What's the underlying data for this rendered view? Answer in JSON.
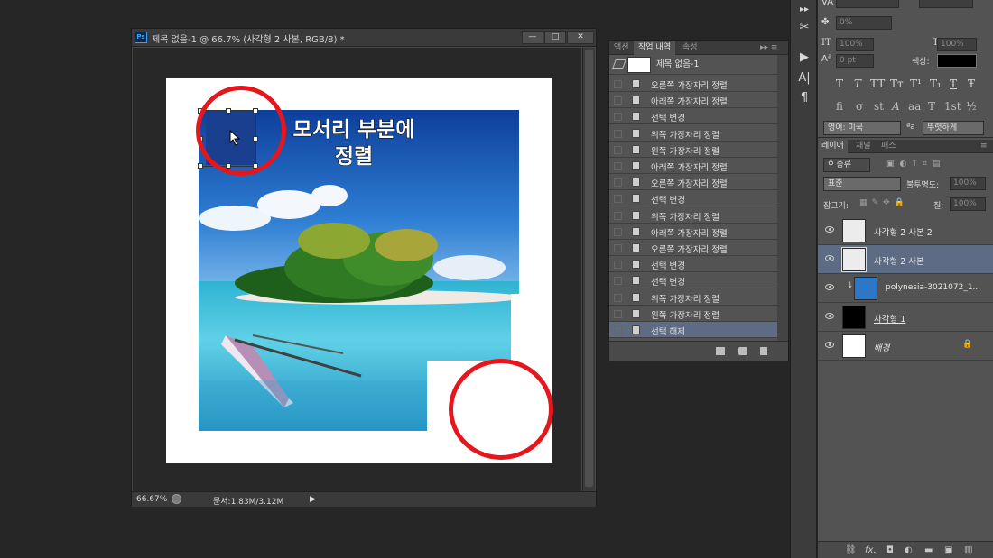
{
  "window": {
    "title": "제목 없음-1 @ 66.7% (사각형 2 사본, RGB/8) *",
    "logo": "Ps",
    "minimize": "—",
    "maximize": "□",
    "close": "✕",
    "zoom": "66.67%",
    "doc_info": "문서:1.83M/3.12M",
    "status_arrow": "▶"
  },
  "canvas": {
    "caption_line1": "모서리 부분에",
    "caption_line2": "정렬"
  },
  "history_panel": {
    "tabs": [
      "액션",
      "작업 내역",
      "속성"
    ],
    "active_tab": "작업 내역",
    "menu": "▸▸ ≡",
    "snapshot": "제목 없음-1",
    "items": [
      "오른쪽 가장자리 정렬",
      "아래쪽 가장자리 정렬",
      "선택 변경",
      "위쪽 가장자리 정렬",
      "왼쪽 가장자리 정렬",
      "아래쪽 가장자리 정렬",
      "오른쪽 가장자리 정렬",
      "선택 변경",
      "위쪽 가장자리 정렬",
      "아래쪽 가장자리 정렬",
      "오른쪽 가장자리 정렬",
      "선택 변경",
      "선택 변경",
      "위쪽 가장자리 정렬",
      "왼쪽 가장자리 정렬",
      "선택 해제"
    ],
    "selected_item": "선택 해제"
  },
  "character_panel": {
    "size_top": "0%",
    "tracking_label": "VA",
    "vertical_scale": "100%",
    "horizontal_scale": "100%",
    "baseline": "0 pt",
    "color_label": "색상:",
    "type_styles": [
      "T",
      "T",
      "TT",
      "Tт",
      "T¹",
      "T₁",
      "T",
      "Ŧ"
    ],
    "opentype": [
      "fi",
      "σ",
      "st",
      "A",
      "aa",
      "T",
      "1st",
      "½"
    ],
    "language": "영어: 미국",
    "aa_icon": "ªa",
    "antialias": "뚜렷하게",
    "colors": {
      "text_color": "#000000"
    }
  },
  "layers_panel": {
    "tabs": [
      "레이어",
      "채널",
      "패스"
    ],
    "active_tab": "레이어",
    "filter": "종류",
    "blend_mode": "표준",
    "opacity_label": "불투명도:",
    "opacity": "100%",
    "lock_label": "잠그기:",
    "fill_label": "칠:",
    "fill": "100%",
    "layers": [
      {
        "name": "사각형 2 사본 2",
        "thumb": "transparent"
      },
      {
        "name": "사각형 2 사본",
        "thumb": "transparent",
        "selected": true
      },
      {
        "name": "polynesia-3021072_1...",
        "thumb": "photo"
      },
      {
        "name": "사각형 1",
        "thumb": "black"
      },
      {
        "name": "배경",
        "thumb": "white",
        "locked": true
      }
    ],
    "bottom_icons": [
      "link-icon",
      "fx-icon",
      "mask-icon",
      "adjustment-icon",
      "group-icon",
      "new-layer-icon",
      "trash-icon"
    ],
    "fx_label": "fx."
  },
  "tool_icons": [
    "scissors-icon",
    "play-icon",
    "character-icon",
    "paragraph-icon"
  ],
  "colors": {
    "accent": "#e5171d",
    "selection": "#5d6b84",
    "panel": "#535353"
  }
}
